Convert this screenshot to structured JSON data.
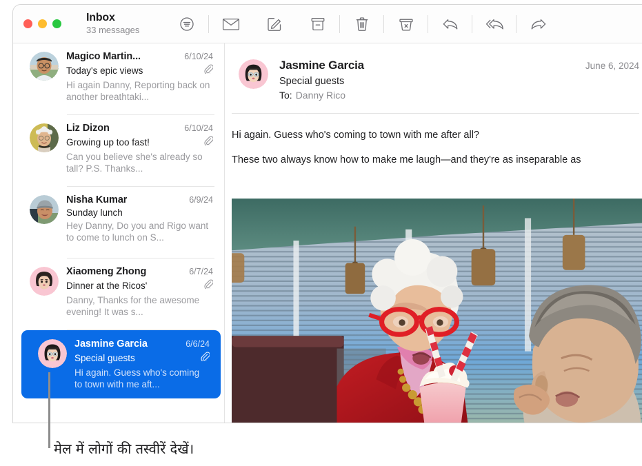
{
  "window": {
    "traffic_lights": [
      {
        "name": "close",
        "color": "#ff5f57"
      },
      {
        "name": "minimize",
        "color": "#febc2e"
      },
      {
        "name": "zoom",
        "color": "#28c840"
      }
    ],
    "title": "Inbox",
    "subtitle": "33 messages"
  },
  "toolbar": {
    "buttons": [
      {
        "icon": "filter-icon",
        "label": "Filter"
      },
      {
        "icon": "mail-icon",
        "label": "Mark as unread"
      },
      {
        "icon": "compose-icon",
        "label": "New message"
      },
      {
        "icon": "archive-icon",
        "label": "Archive"
      },
      {
        "icon": "trash-icon",
        "label": "Delete"
      },
      {
        "icon": "junk-icon",
        "label": "Move to Junk"
      },
      {
        "icon": "reply-icon",
        "label": "Reply"
      },
      {
        "icon": "reply-all-icon",
        "label": "Reply All"
      },
      {
        "icon": "forward-icon",
        "label": "Forward"
      }
    ]
  },
  "message_list": [
    {
      "sender": "Magico Martin...",
      "date": "6/10/24",
      "subject": "Today's epic views",
      "preview": "Hi again Danny, Reporting back on another breathtaki...",
      "attachment": true,
      "selected": false,
      "avatar_type": "photo-man-glasses-cap"
    },
    {
      "sender": "Liz Dizon",
      "date": "6/10/24",
      "subject": "Growing up too fast!",
      "preview": "Can you believe she's already so tall? P.S. Thanks...",
      "attachment": true,
      "selected": false,
      "avatar_type": "photo-woman-short-silver-hair"
    },
    {
      "sender": "Nisha Kumar",
      "date": "6/9/24",
      "subject": "Sunday lunch",
      "preview": "Hey Danny, Do you and Rigo want to come to lunch on S...",
      "attachment": false,
      "selected": false,
      "avatar_type": "photo-woman-beanie"
    },
    {
      "sender": "Xiaomeng Zhong",
      "date": "6/7/24",
      "subject": "Dinner at the Ricos'",
      "preview": "Danny, Thanks for the awesome evening! It was s...",
      "attachment": true,
      "selected": false,
      "avatar_type": "memoji-dark-bob-pink"
    },
    {
      "sender": "Jasmine Garcia",
      "date": "6/6/24",
      "subject": "Special guests",
      "preview": "Hi again. Guess who's coming to town with me aft...",
      "attachment": true,
      "selected": true,
      "avatar_type": "memoji-headband-glasses-pink"
    }
  ],
  "reading_pane": {
    "sender": "Jasmine Garcia",
    "date": "June 6, 2024",
    "subject": "Special guests",
    "to_label": "To:",
    "to_value": "Danny Rico",
    "paragraphs": [
      "Hi again. Guess who's coming to town with me after all?",
      "These two always know how to make me laugh—and they're as inseparable as"
    ],
    "photo_alt": "Two people sharing a pink milkshake with red striped straws in a diner"
  },
  "callout": {
    "caption": "मेल में लोगों की तस्वीरें देखें।"
  },
  "colors": {
    "selection_blue": "#0a6ce7",
    "text_primary": "#1d1d1f",
    "text_secondary": "#8a8a8e"
  }
}
